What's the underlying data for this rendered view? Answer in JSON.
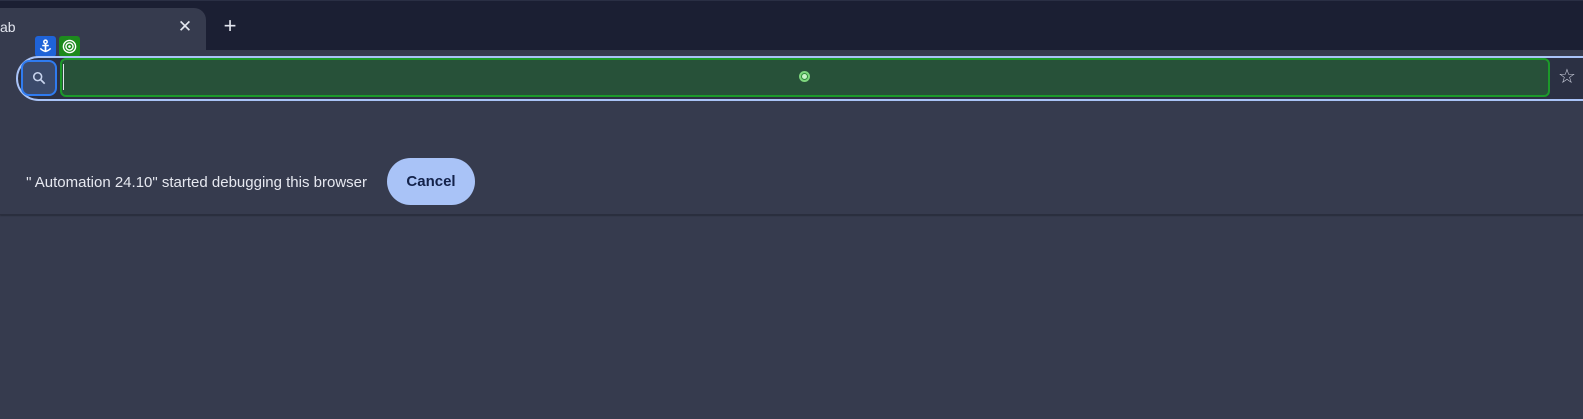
{
  "tabs": [
    {
      "title": "New Tab",
      "visible_fragment": "ab",
      "close_symbol": "✕"
    }
  ],
  "new_tab_symbol": "+",
  "badges": [
    {
      "icon": "anchor-icon"
    },
    {
      "icon": "target-icon"
    }
  ],
  "omnibox": {
    "value": "",
    "placeholder": ""
  },
  "bookmark_star": "☆",
  "infobar": {
    "message": "\" Automation 24.10\" started debugging this browser",
    "cancel_label": "Cancel"
  },
  "colors": {
    "tabstrip_bg": "#1b1f33",
    "page_bg": "#363b4e",
    "omnibox_border": "#a9c3f7",
    "input_highlight": "#275139",
    "input_highlight_border": "#1c9a2a",
    "search_highlight_border": "#2f7bf0",
    "cancel_bg": "#a9c3f7"
  }
}
